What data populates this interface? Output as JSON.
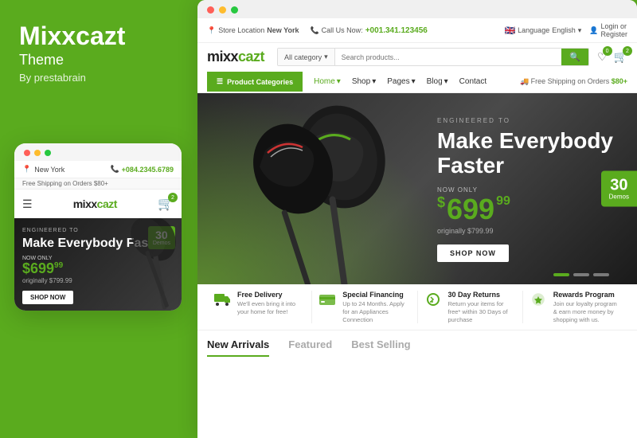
{
  "brand": {
    "name": "Mixxcazt",
    "subtitle": "Theme",
    "by": "By prestabrain",
    "logo_text": "mixxcazt"
  },
  "mobile": {
    "topbar": {
      "location_label": "New York",
      "phone": "+084.2345.6789",
      "shipping": "Free Shipping on Orders $80+"
    },
    "hero": {
      "engineered": "ENGINEERED TO",
      "title": "Make Everybody Faster",
      "now_only": "NOW ONLY",
      "price_main": "$699",
      "price_cents": "99",
      "original_price": "originally $799.99",
      "cta": "SHOP NOW"
    },
    "demos": {
      "count": "30",
      "label": "Demos"
    }
  },
  "desktop": {
    "topbar": {
      "store_location_label": "Store Location",
      "store_location_value": "New York",
      "call_label": "Call Us Now:",
      "phone": "+001.341.123456",
      "language_label": "Language",
      "language_value": "English",
      "login": "Login or",
      "register": "Register"
    },
    "search": {
      "category_placeholder": "All category",
      "input_placeholder": "Search products..."
    },
    "nav": {
      "categories_btn": "Product Categories",
      "links": [
        "Home",
        "Shop",
        "Pages",
        "Blog",
        "Contact"
      ],
      "shipping_text": "Free Shipping on Orders $80+"
    },
    "hero": {
      "engineered": "ENGINEERED TO",
      "title_line1": "Make Everybody",
      "title_line2": "Faster",
      "now_only": "NOW ONLY",
      "price_dollar": "$",
      "price_main": "699",
      "price_cents": "99",
      "original_price": "originally $799.99",
      "cta": "SHOP NOW"
    },
    "demos": {
      "count": "30",
      "label": "Demos"
    },
    "features": [
      {
        "icon": "truck",
        "title": "Free Delivery",
        "desc": "We'll even bring it into your home for free!"
      },
      {
        "icon": "financing",
        "title": "Special Financing",
        "desc": "Up to 24 Months. Apply for an Appliances Connection"
      },
      {
        "icon": "returns",
        "title": "30 Day Returns",
        "desc": "Return your items for free* within 30 Days of purchase"
      },
      {
        "icon": "rewards",
        "title": "Rewards Program",
        "desc": "Join our loyalty program & earn more money by shopping with us."
      }
    ],
    "tabs": [
      {
        "label": "New Arrivals",
        "active": true
      },
      {
        "label": "Featured",
        "active": false
      },
      {
        "label": "Best Selling",
        "active": false
      }
    ]
  },
  "colors": {
    "primary": "#5aab1e",
    "dark": "#222222",
    "light_bg": "#f5f5f5"
  }
}
